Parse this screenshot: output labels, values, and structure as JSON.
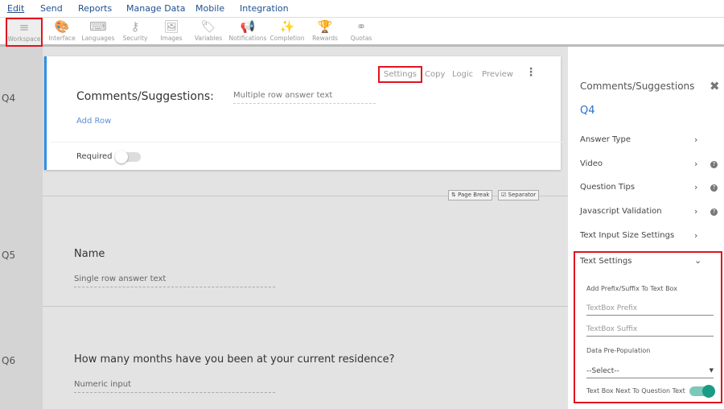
{
  "menu": [
    "Edit",
    "Send",
    "Reports",
    "Manage Data",
    "Mobile",
    "Integration"
  ],
  "tools": [
    {
      "label": "Workspace",
      "icon": "≡"
    },
    {
      "label": "Interface",
      "icon": "🎨"
    },
    {
      "label": "Languages",
      "icon": "⌨"
    },
    {
      "label": "Security",
      "icon": "⚷"
    },
    {
      "label": "Images",
      "icon": "🖼"
    },
    {
      "label": "Variables",
      "icon": "🏷"
    },
    {
      "label": "Notifications",
      "icon": "📢"
    },
    {
      "label": "Completion",
      "icon": "✨"
    },
    {
      "label": "Rewards",
      "icon": "🏆"
    },
    {
      "label": "Quotas",
      "icon": "⚭"
    }
  ],
  "q4": {
    "num": "Q4",
    "title": "Comments/Suggestions:",
    "placeholder": "Multiple row answer text",
    "add_row": "Add Row",
    "required": "Required",
    "actions": [
      "Settings",
      "Copy",
      "Logic",
      "Preview"
    ]
  },
  "breaks": {
    "page_break": "Page Break",
    "separator": "Separator"
  },
  "q5": {
    "num": "Q5",
    "title": "Name",
    "placeholder": "Single row answer text"
  },
  "q6": {
    "num": "Q6",
    "title": "How many months have you been at your current residence?",
    "placeholder": "Numeric input"
  },
  "panel": {
    "title": "Comments/Suggestions",
    "qnum": "Q4",
    "items": [
      "Answer Type",
      "Video",
      "Question Tips",
      "Javascript Validation",
      "Text Input Size Settings",
      "Text Settings"
    ],
    "text_settings": {
      "prefix_label": "Add Prefix/Suffix To Text Box",
      "prefix_placeholder": "TextBox Prefix",
      "suffix_placeholder": "TextBox Suffix",
      "prepop_label": "Data Pre-Population",
      "select_value": "--Select--",
      "next_to_label": "Text Box Next To Question Text"
    }
  },
  "colors": {
    "accent": "#2f8fe6",
    "highlight": "#e0141e",
    "toggle_on": "#1a9b86"
  }
}
